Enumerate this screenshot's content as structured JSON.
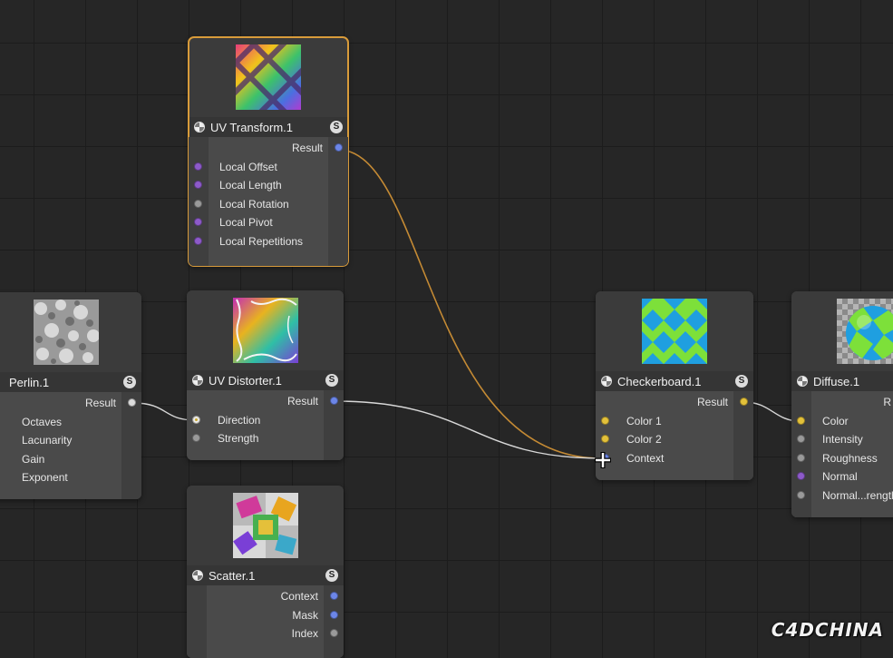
{
  "nodes": {
    "uv_transform": {
      "title": "UV Transform.1",
      "badge": "S",
      "output": "Result",
      "inputs": [
        "Local Offset",
        "Local Length",
        "Local Rotation",
        "Local Pivot",
        "Local Repetitions"
      ]
    },
    "perlin": {
      "title": "Perlin.1",
      "badge": "S",
      "output": "Result",
      "inputs": [
        "Octaves",
        "Lacunarity",
        "Gain",
        "Exponent"
      ]
    },
    "uv_distorter": {
      "title": "UV Distorter.1",
      "badge": "S",
      "output": "Result",
      "inputs": [
        "Direction",
        "Strength"
      ]
    },
    "scatter": {
      "title": "Scatter.1",
      "badge": "S",
      "inputs": [
        "Context",
        "Mask",
        "Index"
      ]
    },
    "checkerboard": {
      "title": "Checkerboard.1",
      "badge": "S",
      "output": "Result",
      "inputs": [
        "Color 1",
        "Color 2",
        "Context"
      ]
    },
    "diffuse": {
      "title": "Diffuse.1",
      "output": "R",
      "inputs": [
        "Color",
        "Intensity",
        "Roughness",
        "Normal",
        "Normal...rength"
      ]
    }
  },
  "watermark": "C4DCHINA",
  "colors": {
    "selection": "#d89b3a",
    "wire_orange": "#c48a34",
    "wire_white": "#d8d8d8",
    "port_purple": "#8d5ac9",
    "port_blue": "#6c86e8",
    "port_yellow": "#e3c13a",
    "port_grey": "#9a9a9a"
  }
}
